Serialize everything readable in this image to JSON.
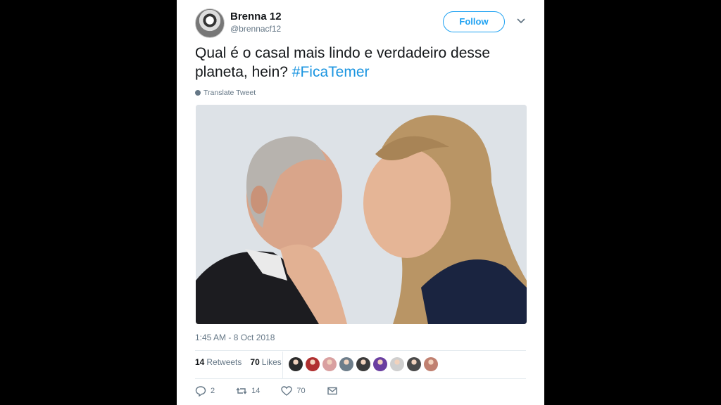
{
  "tweet": {
    "display_name": "Brenna 12",
    "handle": "@brennacf12",
    "follow_label": "Follow",
    "text": "Qual é o casal mais lindo e verdadeiro desse planeta, hein?",
    "hashtag": "#FicaTemer",
    "translate_label": "Translate Tweet",
    "timestamp": "1:45 AM - 8 Oct 2018"
  },
  "stats": {
    "retweets_count": "14",
    "retweets_label": "Retweets",
    "likes_count": "70",
    "likes_label": "Likes"
  },
  "actions": {
    "reply_count": "2",
    "retweet_count": "14",
    "like_count": "70"
  },
  "liker_avatar_colors": [
    "#2b2b2b",
    "#b03030",
    "#d9a0a0",
    "#6d7d8a",
    "#3b3b3b",
    "#6a3fa0",
    "#cfcfcf",
    "#4a4a4a",
    "#c08070"
  ],
  "colors": {
    "accent": "#1da1f2",
    "hashtag": "#1b95e0",
    "muted": "#657786"
  }
}
